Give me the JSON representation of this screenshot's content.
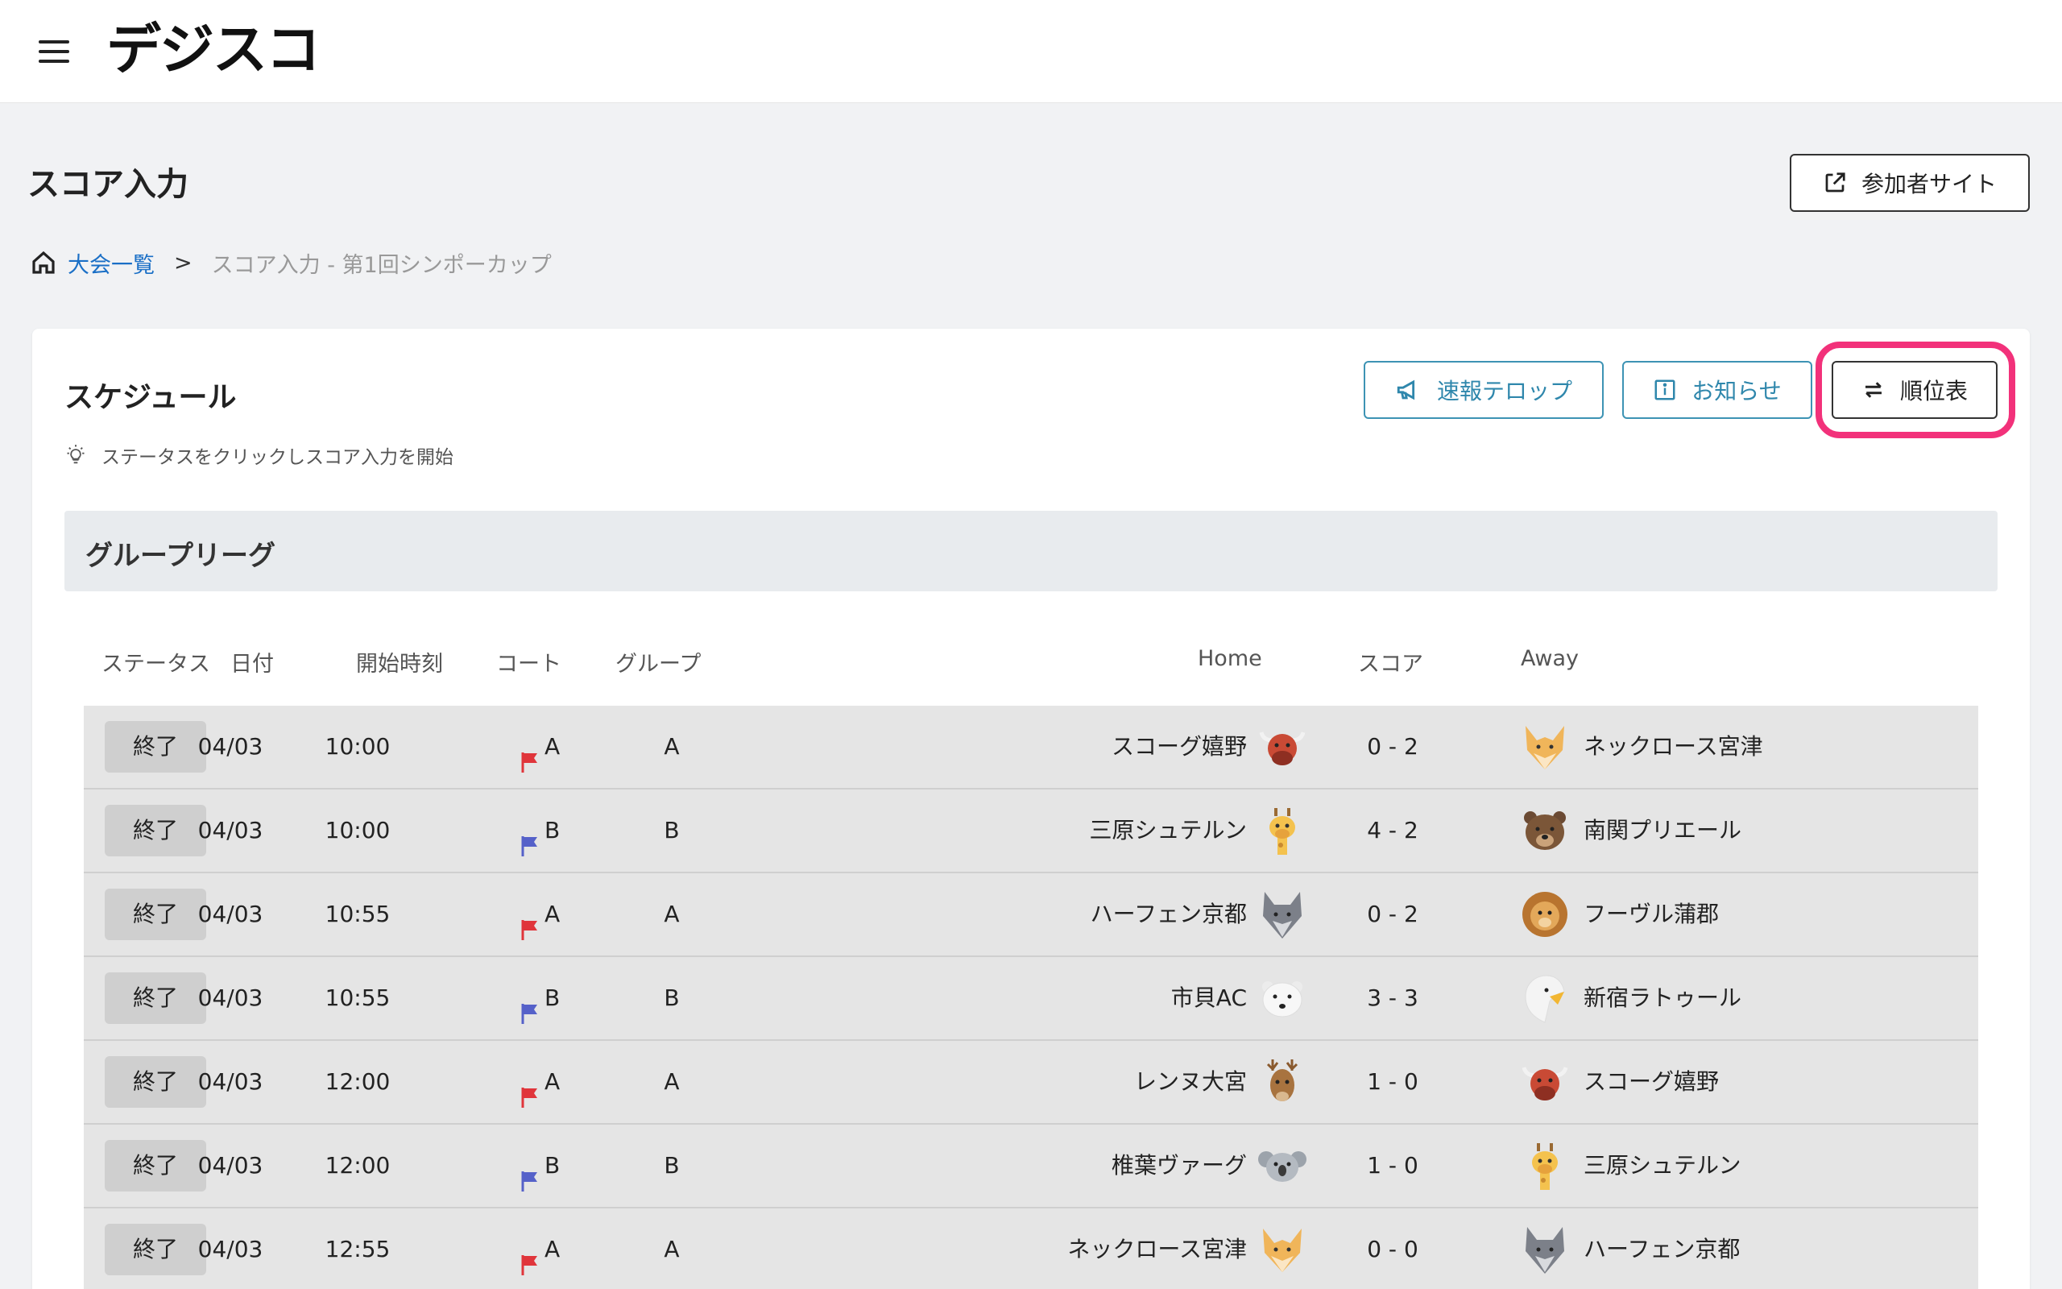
{
  "app": {
    "logo": "デジスコ"
  },
  "header": {
    "page_title": "スコア入力",
    "participant_site_label": "参加者サイト"
  },
  "breadcrumb": {
    "home_link": "大会一覧",
    "separator": ">",
    "current": "スコア入力 - 第1回シンポーカップ"
  },
  "schedule": {
    "title": "スケジュール",
    "hint": "ステータスをクリックしスコア入力を開始",
    "buttons": {
      "ticker": "速報テロップ",
      "notice": "お知らせ",
      "standings": "順位表"
    },
    "group_label": "グループリーグ",
    "columns": {
      "status": "ステータス",
      "date": "日付",
      "start_time": "開始時刻",
      "court": "コート",
      "group": "グループ",
      "home": "Home",
      "score": "スコア",
      "away": "Away"
    },
    "rows": [
      {
        "status": "終了",
        "date": "04/03",
        "time": "10:00",
        "court": "A",
        "group": "A",
        "home": "スコーグ嬉野",
        "score": "0 - 2",
        "away": "ネックロース宮津"
      },
      {
        "status": "終了",
        "date": "04/03",
        "time": "10:00",
        "court": "B",
        "group": "B",
        "home": "三原シュテルン",
        "score": "4 - 2",
        "away": "南関プリエール"
      },
      {
        "status": "終了",
        "date": "04/03",
        "time": "10:55",
        "court": "A",
        "group": "A",
        "home": "ハーフェン京都",
        "score": "0 - 2",
        "away": "フーヴル蒲郡"
      },
      {
        "status": "終了",
        "date": "04/03",
        "time": "10:55",
        "court": "B",
        "group": "B",
        "home": "市貝AC",
        "score": "3 - 3",
        "away": "新宿ラトゥール"
      },
      {
        "status": "終了",
        "date": "04/03",
        "time": "12:00",
        "court": "A",
        "group": "A",
        "home": "レンヌ大宮",
        "score": "1 - 0",
        "away": "スコーグ嬉野"
      },
      {
        "status": "終了",
        "date": "04/03",
        "time": "12:00",
        "court": "B",
        "group": "B",
        "home": "椎葉ヴァーグ",
        "score": "1 - 0",
        "away": "三原シュテルン"
      },
      {
        "status": "終了",
        "date": "04/03",
        "time": "12:55",
        "court": "A",
        "group": "A",
        "home": "ネックロース宮津",
        "score": "0 - 0",
        "away": "ハーフェン京都"
      }
    ]
  },
  "colors": {
    "link": "#1a6fc6",
    "teal_button": "#2f87ac",
    "highlight_ring": "#f2317a",
    "flag_court_a": "#e0353b",
    "flag_court_b": "#5561c9",
    "logo_dots": "#e2262e"
  }
}
